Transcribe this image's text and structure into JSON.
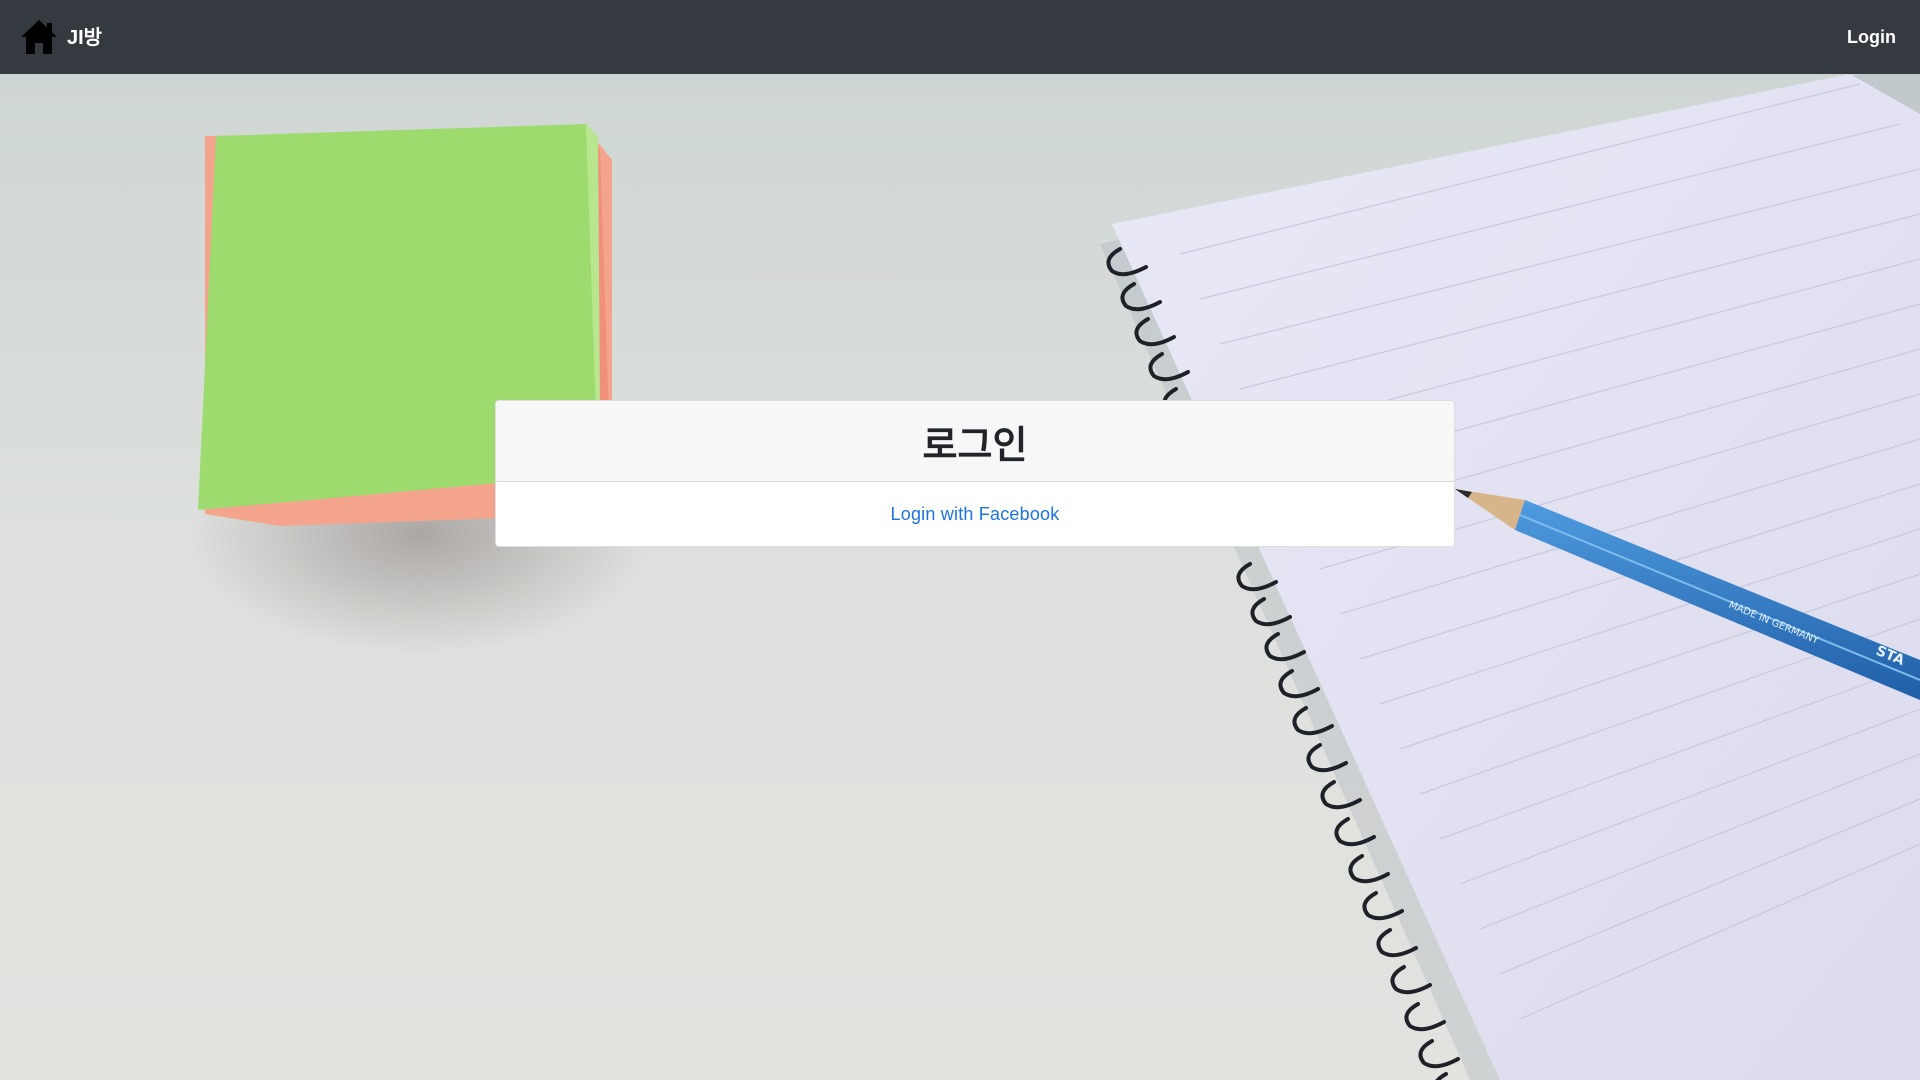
{
  "navbar": {
    "brand_icon": "home-icon",
    "brand_text": "JI방",
    "login_label": "Login",
    "background_color": "#343a40"
  },
  "login_card": {
    "title": "로그인",
    "facebook_link": "Login with Facebook",
    "link_color": "#1b74e4"
  },
  "background_image": {
    "description_icon": "desk-photo",
    "pencil_text": "MADE IN GERMANY",
    "pencil_brand": "STA"
  }
}
